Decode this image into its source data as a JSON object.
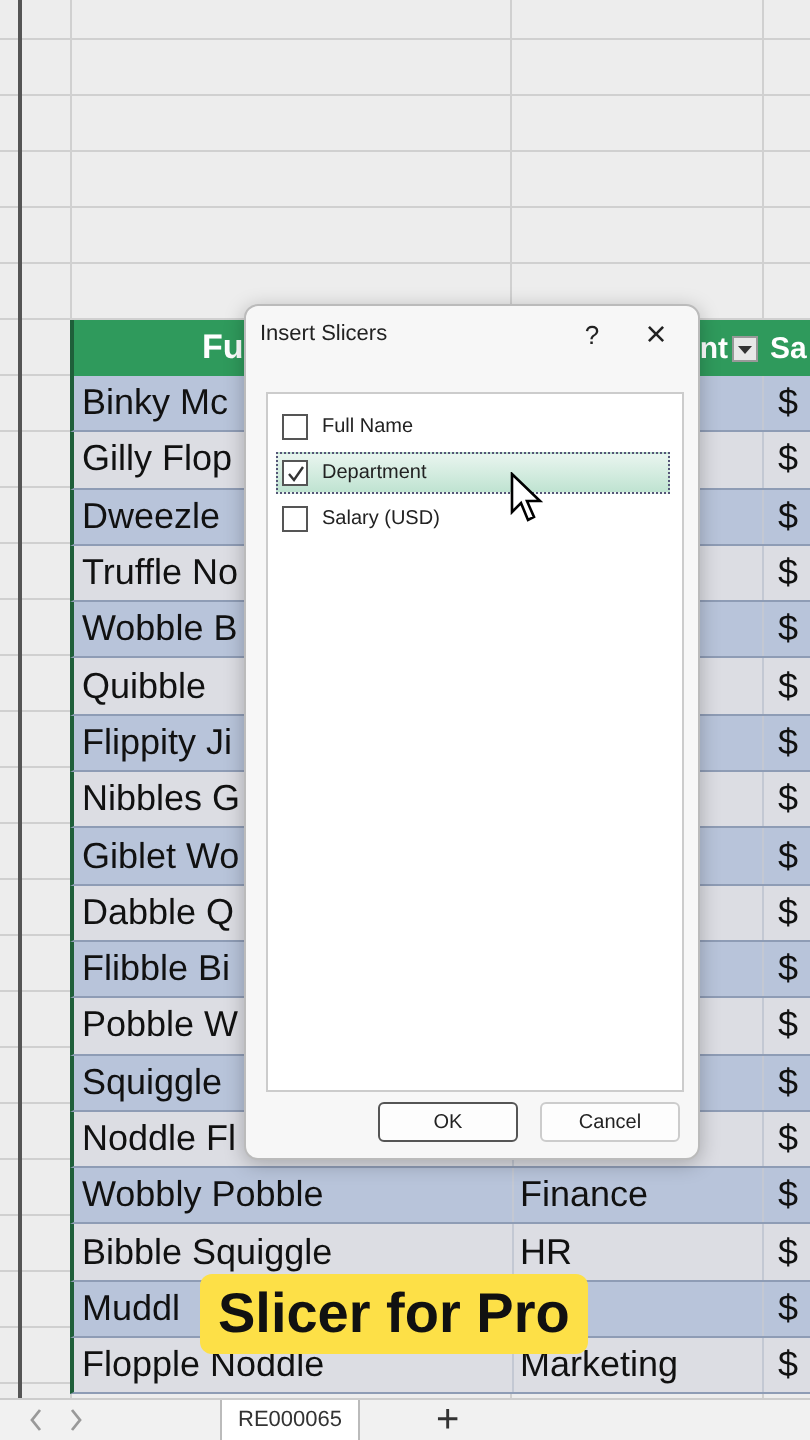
{
  "table": {
    "headers": [
      {
        "text": "Fu"
      },
      {
        "text": "nt",
        "filter": true
      },
      {
        "text": "Sa"
      }
    ],
    "rows": [
      {
        "name": "Binky Mc",
        "salary": "$"
      },
      {
        "name": "Gilly Flop",
        "salary": "$"
      },
      {
        "name": "Dweezle",
        "salary": "$"
      },
      {
        "name": "Truffle No",
        "salary": "$"
      },
      {
        "name": "Wobble B",
        "salary": "$"
      },
      {
        "name": "Quibble",
        "salary": "$"
      },
      {
        "name": "Flippity Ji",
        "salary": "$"
      },
      {
        "name": "Nibbles G",
        "salary": "$"
      },
      {
        "name": "Giblet Wo",
        "salary": "$"
      },
      {
        "name": "Dabble Q",
        "salary": "$"
      },
      {
        "name": "Flibble Bi",
        "salary": "$"
      },
      {
        "name": "Pobble W",
        "salary": "$"
      },
      {
        "name": "Squiggle",
        "salary": "$"
      },
      {
        "name": "Noddle Fl",
        "salary": "$"
      },
      {
        "name": "Wobbly Pobble",
        "department": "Finance",
        "salary": "$"
      },
      {
        "name": "Bibble Squiggle",
        "department": "HR",
        "salary": "$"
      },
      {
        "name": "Muddl",
        "salary": "$"
      },
      {
        "name": "Flopple Noddle",
        "department": "Marketing",
        "salary": "$"
      }
    ]
  },
  "dialog": {
    "title": "Insert Slicers",
    "help": "?",
    "close": "×",
    "fields": [
      {
        "label": "Full Name",
        "checked": false,
        "selected": false
      },
      {
        "label": "Department",
        "checked": true,
        "selected": true
      },
      {
        "label": "Salary (USD)",
        "checked": false,
        "selected": false
      }
    ],
    "buttons": [
      {
        "label": "OK",
        "default": true
      },
      {
        "label": "Cancel",
        "default": false
      }
    ]
  },
  "sheet_tabs": {
    "tabs": [
      {
        "label": "RE000065",
        "selected": true
      }
    ],
    "add": "+"
  },
  "caption": "Slicer for Pro"
}
